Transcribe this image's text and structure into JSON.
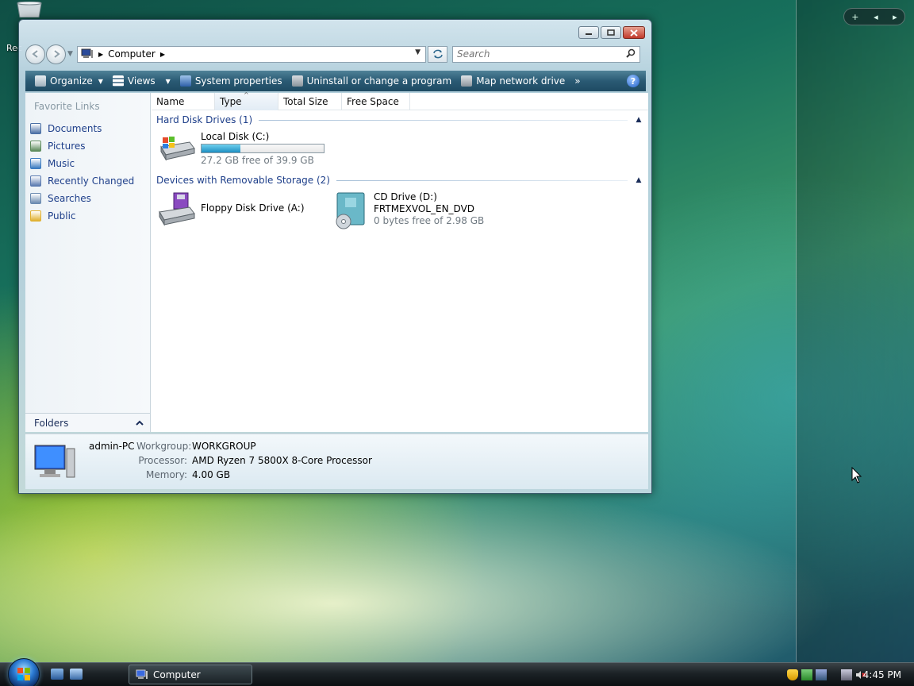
{
  "desktop": {
    "recycle_label": "Rec"
  },
  "gadgets": {
    "add_label": "+",
    "prev_label": "◂",
    "next_label": "▸"
  },
  "window": {
    "address": {
      "breadcrumb": "Computer"
    },
    "search": {
      "placeholder": "Search"
    },
    "toolbar": {
      "organize": "Organize",
      "views": "Views",
      "system_properties": "System properties",
      "uninstall": "Uninstall or change a program",
      "map_drive": "Map network drive",
      "more": "»",
      "help": "?"
    },
    "nav_pane": {
      "title": "Favorite Links",
      "items": [
        {
          "label": "Documents",
          "color": "#4a6fa5"
        },
        {
          "label": "Pictures",
          "color": "#5b8a5a"
        },
        {
          "label": "Music",
          "color": "#3a7ac0"
        },
        {
          "label": "Recently Changed",
          "color": "#5a7ab0"
        },
        {
          "label": "Searches",
          "color": "#6a8ab0"
        },
        {
          "label": "Public",
          "color": "#e0b030"
        }
      ],
      "folders_label": "Folders"
    },
    "columns": [
      "Name",
      "Type",
      "Total Size",
      "Free Space"
    ],
    "groups": {
      "hdd": {
        "title": "Hard Disk Drives (1)",
        "drives": [
          {
            "name": "Local Disk (C:)",
            "free": "27.2 GB free of 39.9 GB",
            "used_fraction": 0.32
          }
        ]
      },
      "removable": {
        "title": "Devices with Removable Storage (2)",
        "drives": [
          {
            "name": "Floppy Disk Drive (A:)"
          },
          {
            "name": "CD Drive (D:)",
            "label": "FRTMEXVOL_EN_DVD",
            "free": "0 bytes free of 2.98 GB"
          }
        ]
      }
    },
    "details": {
      "pc_name": "admin-PC",
      "workgroup_label": "Workgroup:",
      "workgroup": "WORKGROUP",
      "processor_label": "Processor:",
      "processor": "AMD Ryzen 7 5800X 8-Core Processor",
      "memory_label": "Memory:",
      "memory": "4.00 GB"
    }
  },
  "taskbar": {
    "task_label": "Computer",
    "clock": "4:45 PM"
  },
  "colors": {
    "toolbar_blue": "#2a5a74",
    "link_blue": "#1e3f8a",
    "progress_fill": "#1e8fc2"
  }
}
